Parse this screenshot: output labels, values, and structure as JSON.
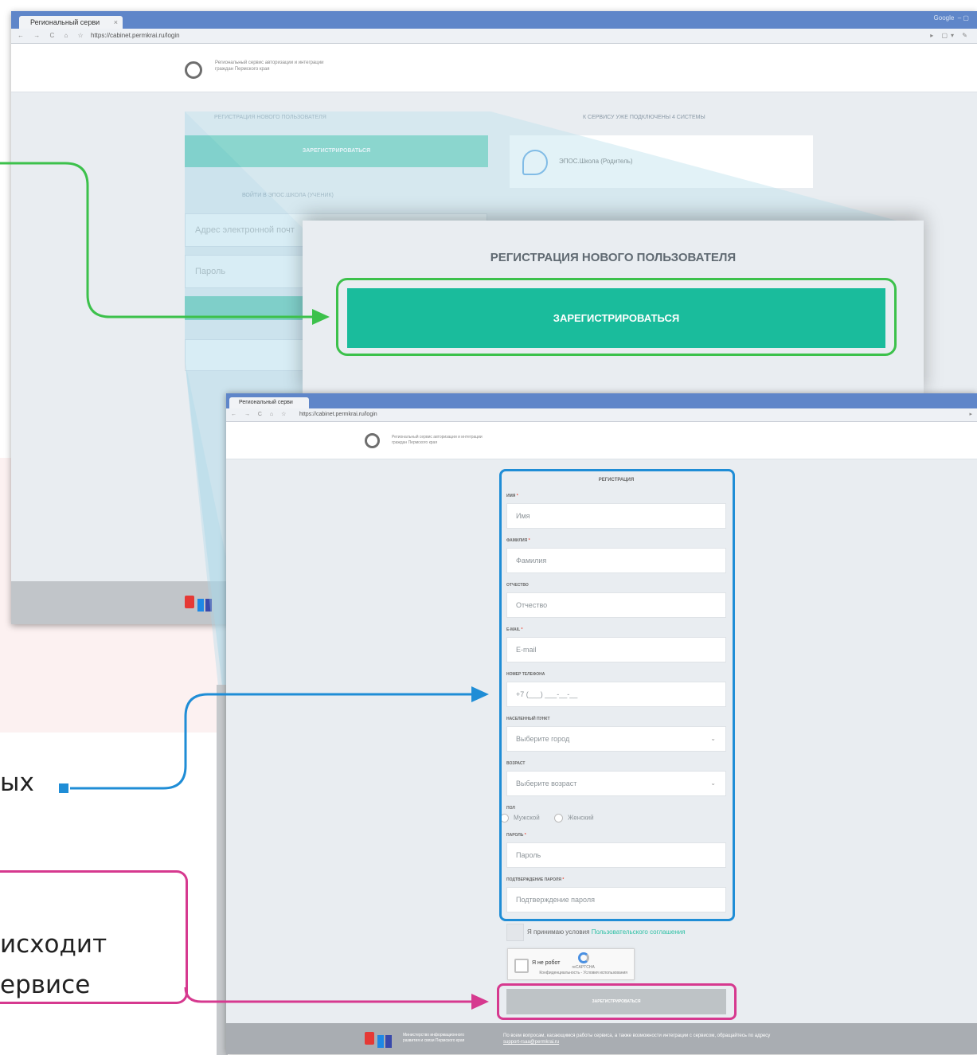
{
  "colors": {
    "green": "#3cc14b",
    "blue": "#1f8dd6",
    "pink": "#d6398f",
    "teal": "#1abc9c"
  },
  "browser1": {
    "tab_title": "Региональный серви",
    "url": "https://cabinet.permkrai.ru/login",
    "logo_text": "Региональный сервис авторизации и интеграции граждан Пермского края",
    "left_heading": "Регистрация нового пользователя",
    "right_heading": "К сервису уже подключены 4 системы",
    "register_label": "ЗАРЕГИСТРИРОВАТЬСЯ",
    "system_name": "ЭПОС.Школа (Родитель)",
    "login_heading": "Войти в ЭПОС.Школа (ученик)",
    "email_placeholder": "Адрес электронной почт",
    "password_placeholder": "Пароль",
    "top_right": "Google"
  },
  "zoom": {
    "heading": "РЕГИСТРАЦИЯ НОВОГО ПОЛЬЗОВАТЕЛЯ",
    "button": "ЗАРЕГИСТРИРОВАТЬСЯ"
  },
  "browser2": {
    "tab_title": "Региональный серви",
    "url": "https://cabinet.permkrai.ru/login",
    "logo_text": "Региональный сервис авторизации и интеграции граждан Пермского края"
  },
  "form": {
    "title": "РЕГИСТРАЦИЯ",
    "fields": [
      {
        "label": "ИМЯ",
        "required": true,
        "placeholder": "Имя"
      },
      {
        "label": "ФАМИЛИЯ",
        "required": true,
        "placeholder": "Фамилия"
      },
      {
        "label": "ОТЧЕСТВО",
        "required": false,
        "placeholder": "Отчество"
      },
      {
        "label": "E-MAIL",
        "required": true,
        "placeholder": "E-mail"
      },
      {
        "label": "НОМЕР ТЕЛЕФОНА",
        "required": false,
        "placeholder": "+7 (___) ___-__-__"
      },
      {
        "label": "НАСЕЛЕННЫЙ ПУНКТ",
        "required": false,
        "placeholder": "Выберите город"
      },
      {
        "label": "ВОЗРАСТ",
        "required": false,
        "placeholder": "Выберите возраст"
      }
    ],
    "gender_label": "ПОЛ",
    "gender_male": "Мужской",
    "gender_female": "Женский",
    "password_label": "ПАРОЛЬ",
    "password_placeholder": "Пароль",
    "confirm_label": "ПОДТВЕРЖДЕНИЕ ПАРОЛЯ",
    "confirm_placeholder": "Подтверждение пароля",
    "required_mark": "*",
    "agree_text": "Я принимаю условия ",
    "agree_link": "Пользовательского соглашения",
    "captcha_label": "Я не робот",
    "captcha_brand": "reCAPTCHA",
    "captcha_sub": "Конфиденциальность - Условия использования",
    "submit": "ЗАРЕГИСТРИРОВАТЬСЯ"
  },
  "footer": {
    "ministry": "Министерство информационного развития и связи Пермского края",
    "question": "По всем вопросам, касающимся работы сервиса, а также возможности интеграции с сервисом, обращайтесь по адресу",
    "email": "support-rsaa@permkrai.ru"
  },
  "slide": {
    "text1": "ых",
    "text2": "исходит",
    "text3": "ервисе"
  }
}
